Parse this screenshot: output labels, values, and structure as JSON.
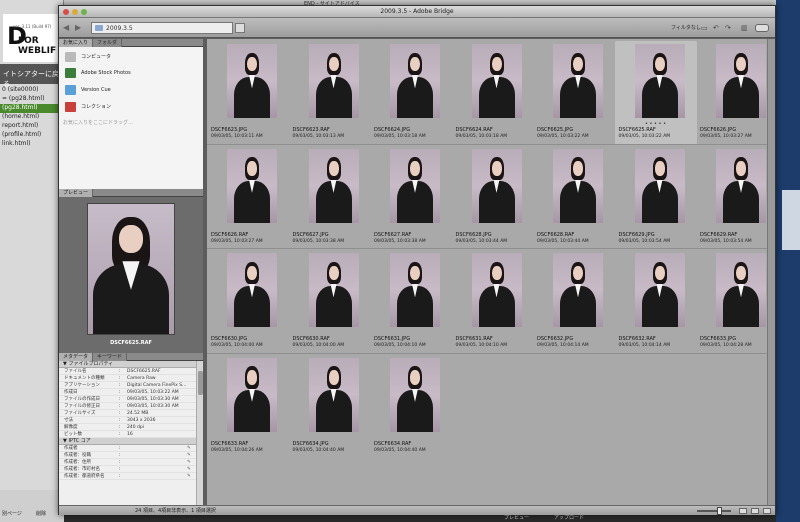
{
  "background_app": {
    "logo_text": "D",
    "logo_small": "ver. 3.11 (Build 97)",
    "logo_brand": "FOR WEBLIF",
    "goto_button": "イトシアターに戻る",
    "files": [
      {
        "name": "0 (site0000)",
        "selected": false
      },
      {
        "name": "= (pg28.html)",
        "selected": false
      },
      {
        "name": "(pg28.html)",
        "selected": true
      },
      {
        "name": "(home.html)",
        "selected": false
      },
      {
        "name": "report.html)",
        "selected": false
      },
      {
        "name": "(profile.html)",
        "selected": false
      },
      {
        "name": "link.html)",
        "selected": false
      }
    ],
    "bottom_labels": [
      "別ページ",
      "追加",
      "削除"
    ],
    "top_menu": "END - サイトアドバイス",
    "bottom_bar_labels": [
      "プレビュー",
      "アップロード"
    ]
  },
  "window": {
    "title": "2009.3.5 - Adobe Bridge",
    "path": "2009.3.5",
    "filter_label": "フィルタなし"
  },
  "favorites": {
    "tabs": [
      "お気に入り",
      "フォルダ"
    ],
    "items": [
      {
        "label": "コンピュータ",
        "icon": "computer-icon",
        "color": "#b9b9b9"
      },
      {
        "label": "Adobe Stock Photos",
        "icon": "stock-photos-icon",
        "color": "#3b7d3b"
      },
      {
        "label": "Version Cue",
        "icon": "version-cue-icon",
        "color": "#5aa0d8"
      },
      {
        "label": "コレクション",
        "icon": "collection-icon",
        "color": "#c8403c"
      }
    ],
    "hint": "お気に入りをここにドラッグ..."
  },
  "preview": {
    "tab": "プレビュー",
    "filename": "DSCF6625.RAF"
  },
  "metadata": {
    "tabs": [
      "メタデータ",
      "キーワード"
    ],
    "file_props_header": "ファイルプロパティ",
    "file_props": [
      {
        "k": "ファイル名",
        "v": "DSCF6625.RAF"
      },
      {
        "k": "ドキュメントの種類",
        "v": "Camera Raw"
      },
      {
        "k": "アプリケーション",
        "v": "Digital Camera FinePix S..."
      },
      {
        "k": "作成日",
        "v": "09/03/05, 10:03:22 AM"
      },
      {
        "k": "ファイルの作成日",
        "v": "09/03/05, 10:03:30 AM"
      },
      {
        "k": "ファイルの修正日",
        "v": "09/03/05, 10:03:30 AM"
      },
      {
        "k": "ファイルサイズ",
        "v": "24.52 MB"
      },
      {
        "k": "寸法",
        "v": "3043 x 2036"
      },
      {
        "k": "解像度",
        "v": "240 dpi"
      },
      {
        "k": "ビット数",
        "v": "16"
      }
    ],
    "iptc_header": "IPTC コア",
    "iptc": [
      {
        "k": "作成者"
      },
      {
        "k": "作成者：役職"
      },
      {
        "k": "作成者：住所"
      },
      {
        "k": "作成者：市町村名"
      },
      {
        "k": "作成者：都道府県名"
      }
    ]
  },
  "thumbnails": [
    {
      "name": "DSCF6623.JPG",
      "date": "09/03/05, 10:03:11 AM"
    },
    {
      "name": "DSCF6623.RAF",
      "date": "09/03/05, 10:03:13 AM"
    },
    {
      "name": "DSCF6624.JPG",
      "date": "09/03/05, 10:03:18 AM"
    },
    {
      "name": "DSCF6624.RAF",
      "date": "09/03/05, 10:03:18 AM"
    },
    {
      "name": "DSCF6625.JPG",
      "date": "09/03/05, 10:03:22 AM"
    },
    {
      "name": "DSCF6625.RAF",
      "date": "09/03/05, 10:03:22 AM",
      "selected": true,
      "dots": "• • • • •"
    },
    {
      "name": "DSCF6626.JPG",
      "date": "09/03/05, 10:03:27 AM"
    },
    {
      "name": "DSCF6626.RAF",
      "date": "09/03/05, 10:03:27 AM"
    },
    {
      "name": "DSCF6627.JPG",
      "date": "09/03/05, 10:03:38 AM"
    },
    {
      "name": "DSCF6627.RAF",
      "date": "09/03/05, 10:03:38 AM"
    },
    {
      "name": "DSCF6628.JPG",
      "date": "09/03/05, 10:03:44 AM"
    },
    {
      "name": "DSCF6628.RAF",
      "date": "09/03/05, 10:03:44 AM"
    },
    {
      "name": "DSCF6629.JPG",
      "date": "09/03/05, 10:03:54 AM"
    },
    {
      "name": "DSCF6629.RAF",
      "date": "09/03/05, 10:03:54 AM"
    },
    {
      "name": "DSCF6630.JPG",
      "date": "09/03/05, 10:04:00 AM"
    },
    {
      "name": "DSCF6630.RAF",
      "date": "09/03/05, 10:04:00 AM"
    },
    {
      "name": "DSCF6631.JPG",
      "date": "09/03/05, 10:04:10 AM"
    },
    {
      "name": "DSCF6631.RAF",
      "date": "09/03/05, 10:04:10 AM"
    },
    {
      "name": "DSCF6632.JPG",
      "date": "09/03/05, 10:04:14 AM"
    },
    {
      "name": "DSCF6632.RAF",
      "date": "09/03/05, 10:04:14 AM"
    },
    {
      "name": "DSCF6633.JPG",
      "date": "09/03/05, 10:04:28 AM"
    },
    {
      "name": "DSCF6633.RAF",
      "date": "09/03/05, 10:04:26 AM"
    },
    {
      "name": "DSCF6634.JPG",
      "date": "09/03/05, 10:04:40 AM"
    },
    {
      "name": "DSCF6634.RAF",
      "date": "09/03/05, 10:04:40 AM"
    }
  ],
  "status": {
    "count": "24 項目、4項目非表示、1 項目選択"
  }
}
